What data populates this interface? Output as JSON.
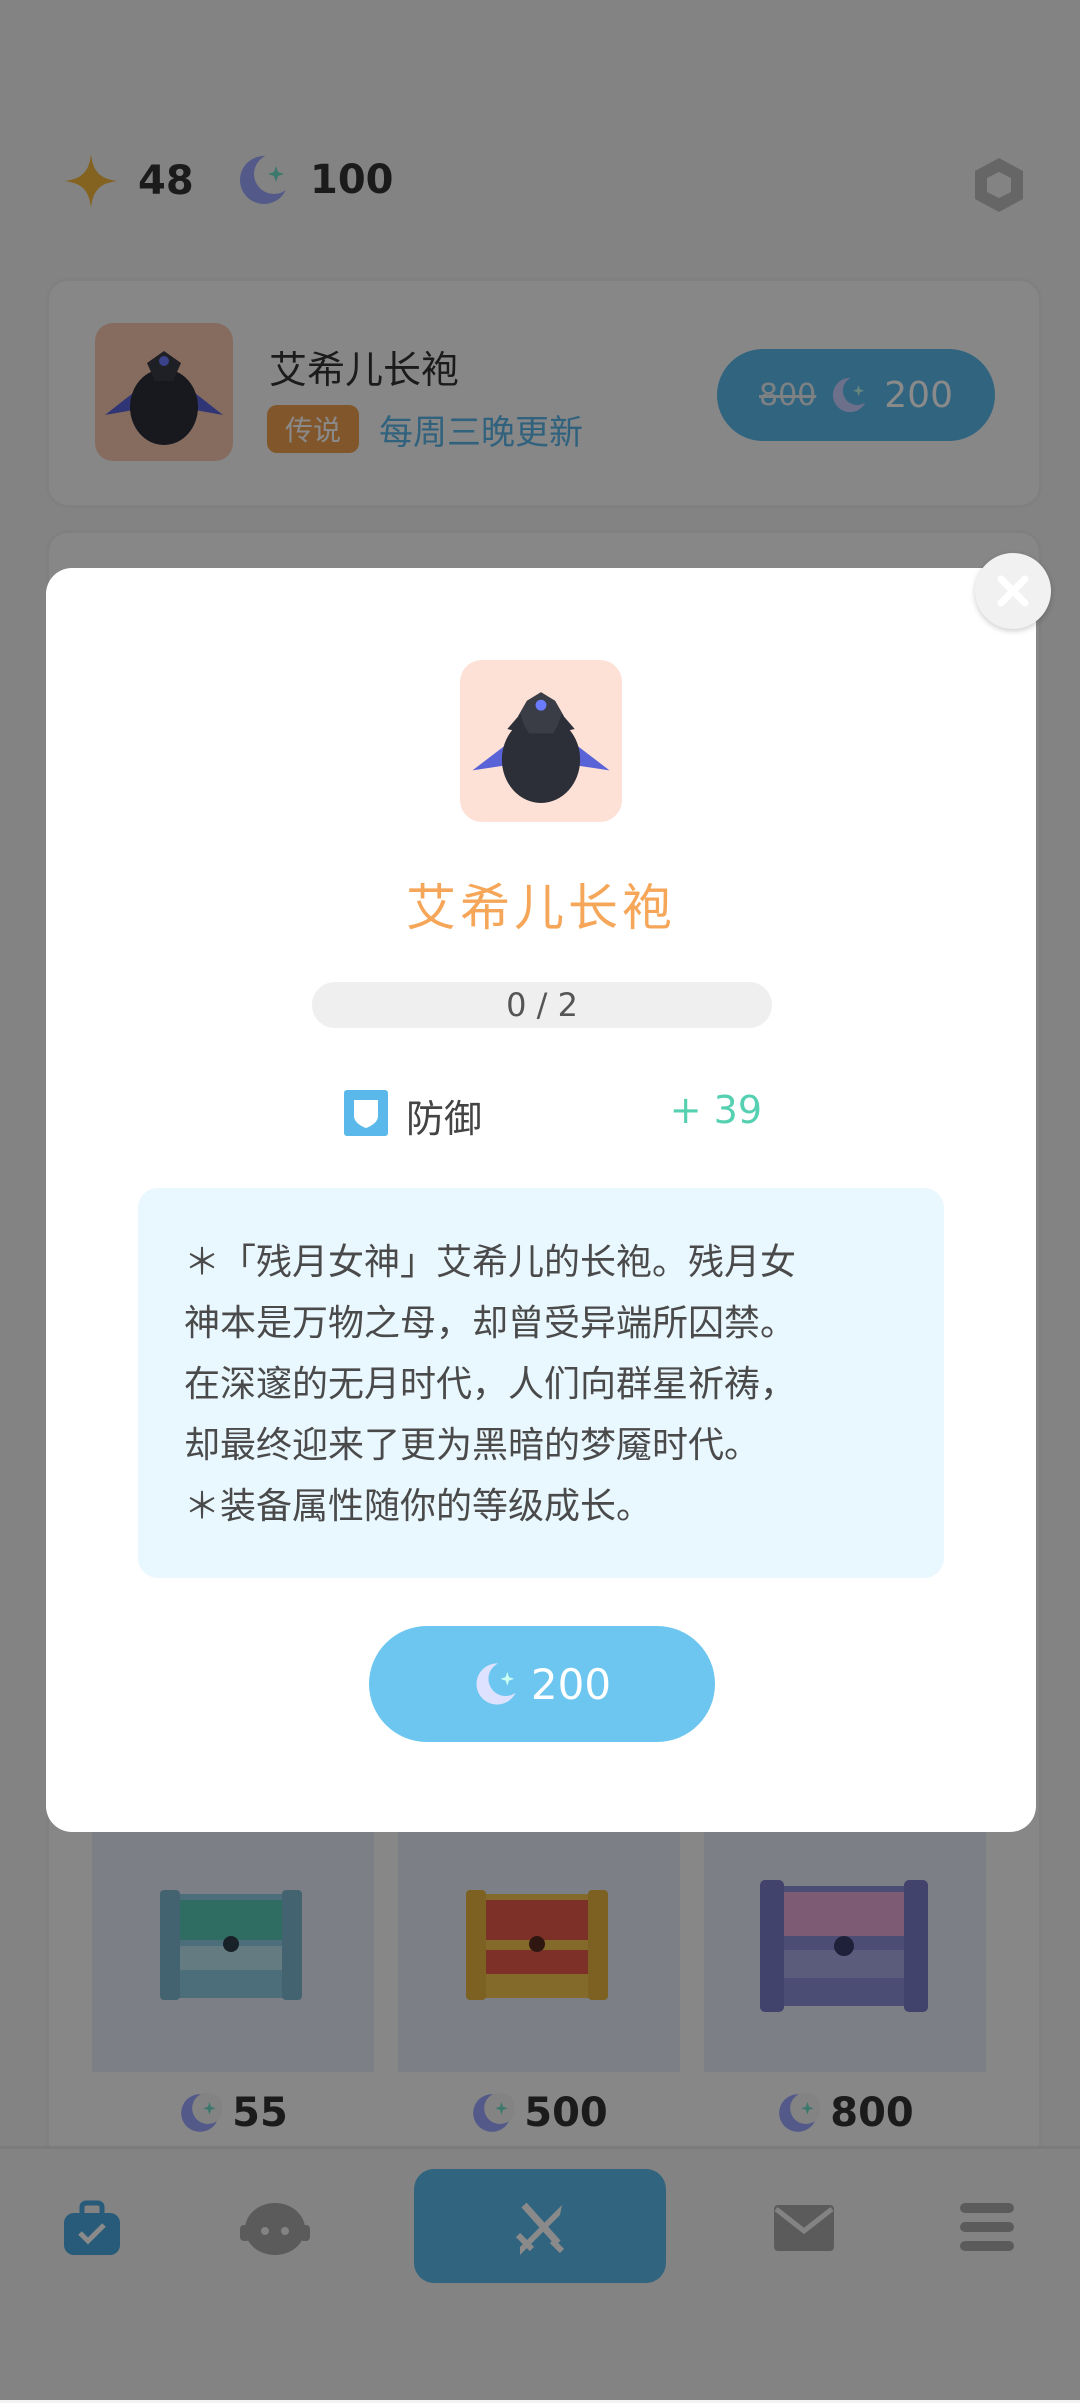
{
  "currency": {
    "stars": "48",
    "moons": "100"
  },
  "featured": {
    "name": "艾希儿长袍",
    "rarity": "传说",
    "refresh_note": "每周三晚更新",
    "old_price": "800",
    "price": "200"
  },
  "chests": [
    {
      "price": "55"
    },
    {
      "price": "500"
    },
    {
      "price": "800"
    }
  ],
  "modal": {
    "item_name": "艾希儿长袍",
    "progress_text": "0 / 2",
    "progress_fraction": 0,
    "stat_label": "防御",
    "stat_value": "+ 39",
    "desc_lines": [
      "＊「残月女神」艾希儿的长袍。残月女",
      "神本是万物之母，却曾受异端所囚禁。",
      "在深邃的无月时代，人们向群星祈祷，",
      "却最终迎来了更为黑暗的梦魇时代。",
      "＊装备属性随你的等级成长。"
    ],
    "buy_price": "200"
  },
  "icons": {
    "star": "star-icon",
    "moon": "moon-icon",
    "settings": "hexagon-settings-icon",
    "close": "close-icon",
    "shield": "shield-icon",
    "robe": "robe-icon",
    "chest": "chest-icon",
    "nav": [
      "bag-icon",
      "character-icon",
      "sword-icon",
      "mail-icon",
      "menu-icon"
    ]
  },
  "colors": {
    "accent": "#5ab9ea",
    "title": "#f6a659",
    "stat_value": "#55d0b0",
    "rarity": "#f0a050"
  }
}
